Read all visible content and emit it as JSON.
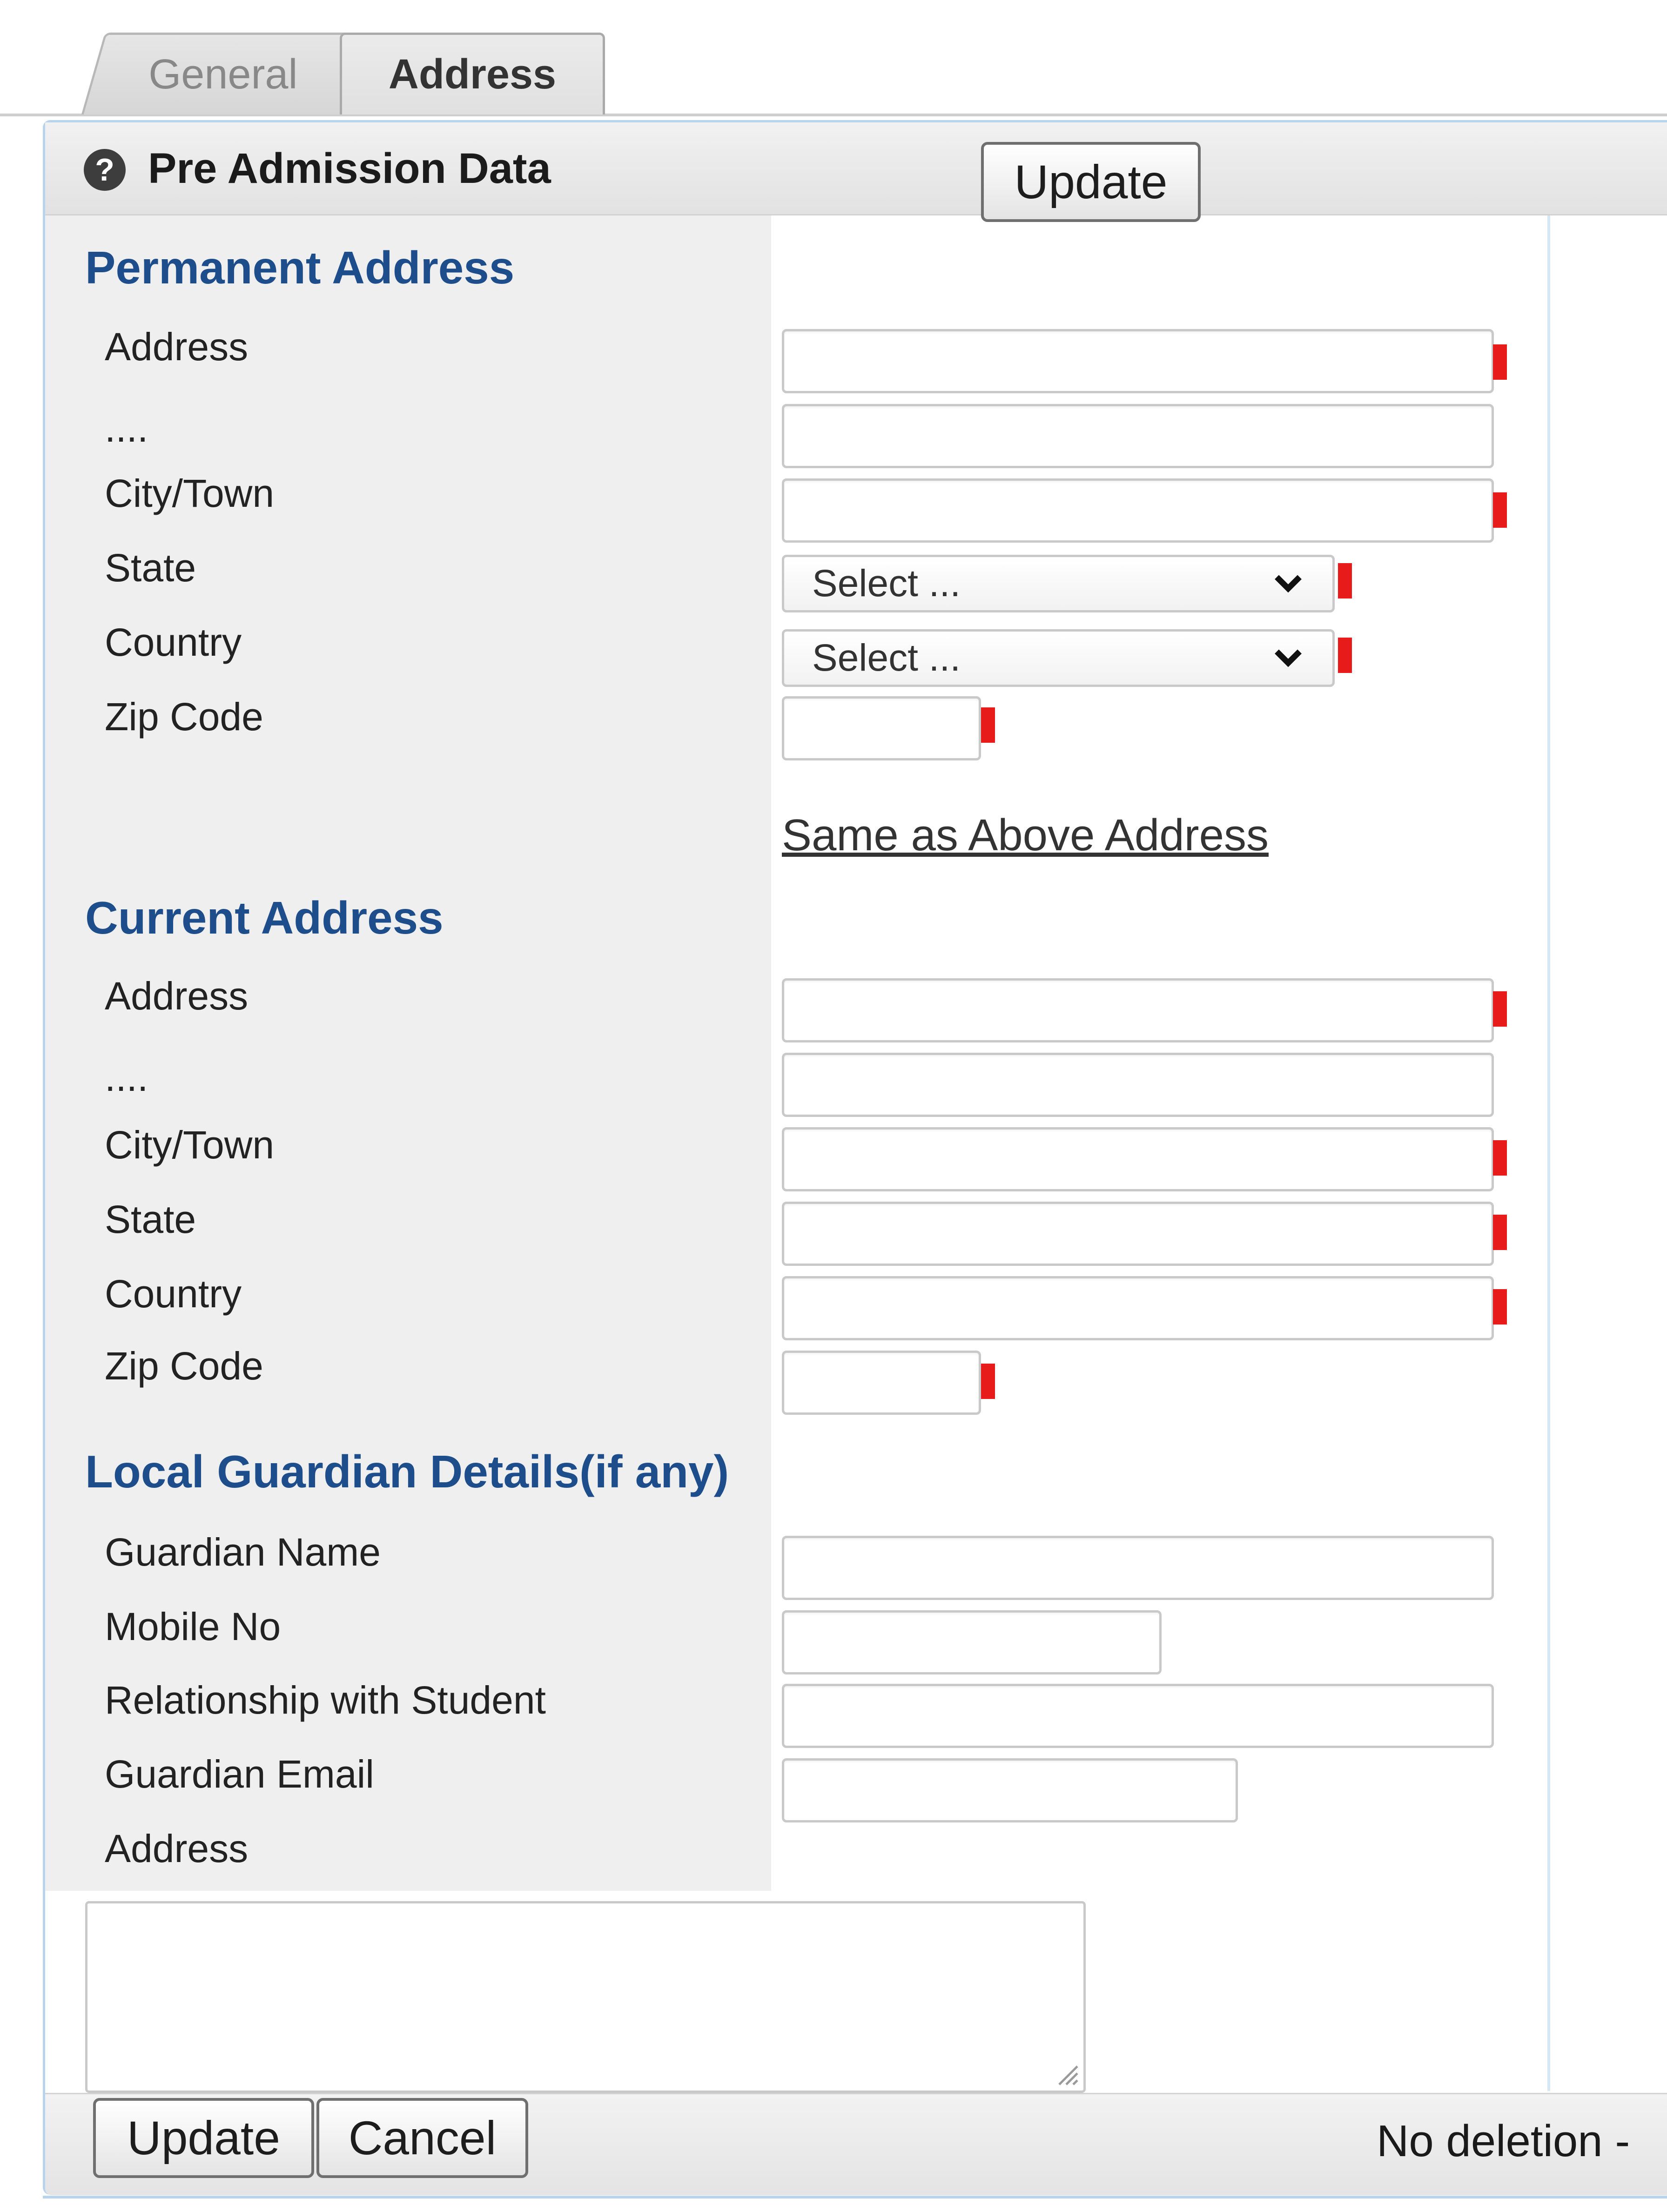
{
  "tabs": [
    {
      "label": "General",
      "active": false
    },
    {
      "label": "Address",
      "active": true
    }
  ],
  "header": {
    "title": "Pre Admission Data",
    "help_icon": "?",
    "update_label": "Update"
  },
  "permanent": {
    "heading": "Permanent Address",
    "labels": {
      "address": "Address",
      "address2": "....",
      "city": "City/Town",
      "state": "State",
      "country": "Country",
      "zip": "Zip Code"
    },
    "values": {
      "address": "",
      "address2": "",
      "city": "",
      "zip": ""
    },
    "state_select": "Select ...",
    "country_select": "Select ..."
  },
  "same_as_above": "Same as Above Address",
  "current": {
    "heading": "Current Address",
    "labels": {
      "address": "Address",
      "address2": "....",
      "city": "City/Town",
      "state": "State",
      "country": "Country",
      "zip": "Zip Code"
    },
    "values": {
      "address": "",
      "address2": "",
      "city": "",
      "state": "",
      "country": "",
      "zip": ""
    }
  },
  "guardian": {
    "heading": "Local Guardian Details(if any)",
    "labels": {
      "name": "Guardian Name",
      "mobile": "Mobile No",
      "relationship": "Relationship with Student",
      "email": "Guardian Email",
      "address": "Address"
    },
    "values": {
      "name": "",
      "mobile": "",
      "relationship": "",
      "email": "",
      "address": ""
    }
  },
  "footer": {
    "update_label": "Update",
    "cancel_label": "Cancel",
    "status": "No deletion -"
  },
  "colors": {
    "section_heading": "#1e4d8c",
    "required_marker": "#e81b1b",
    "panel_border": "#b8d4ec"
  },
  "icons": {
    "help": "help-icon",
    "select_arrow": "chevron-down-icon",
    "resize": "resize-grip-icon"
  }
}
